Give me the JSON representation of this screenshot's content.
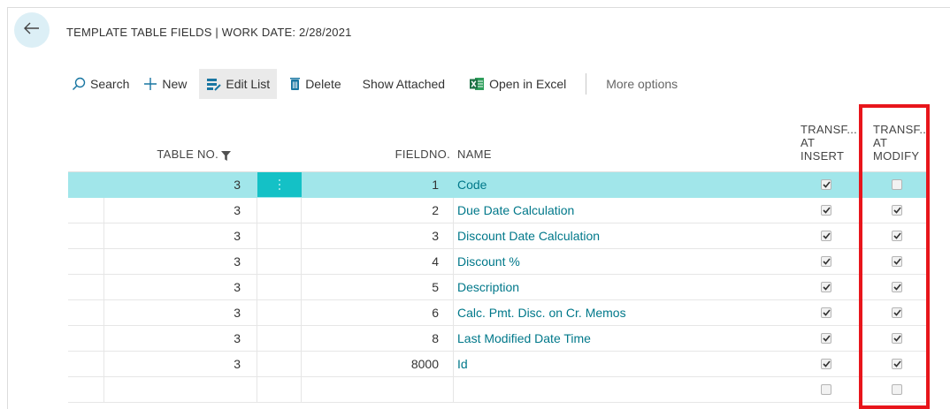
{
  "page": {
    "title": "TEMPLATE TABLE FIELDS | WORK DATE: 2/28/2021"
  },
  "toolbar": {
    "search_label": "Search",
    "new_label": "New",
    "edit_list_label": "Edit List",
    "delete_label": "Delete",
    "show_attached_label": "Show Attached",
    "open_excel_label": "Open in Excel",
    "more_options_label": "More options"
  },
  "columns": {
    "table_no": "TABLE NO.",
    "field_no": "FIELDNO.",
    "name": "NAME",
    "insert_line1": "TRANSF...",
    "insert_line2": "AT",
    "insert_line3": "INSERT",
    "modify_line1": "TRANSF...",
    "modify_line2": "AT",
    "modify_line3": "MODIFY"
  },
  "rows": [
    {
      "table_no": "3",
      "field_no": "1",
      "name": "Code",
      "insert": true,
      "modify": false,
      "selected": true
    },
    {
      "table_no": "3",
      "field_no": "2",
      "name": "Due Date Calculation",
      "insert": true,
      "modify": true
    },
    {
      "table_no": "3",
      "field_no": "3",
      "name": "Discount Date Calculation",
      "insert": true,
      "modify": true
    },
    {
      "table_no": "3",
      "field_no": "4",
      "name": "Discount %",
      "insert": true,
      "modify": true
    },
    {
      "table_no": "3",
      "field_no": "5",
      "name": "Description",
      "insert": true,
      "modify": true
    },
    {
      "table_no": "3",
      "field_no": "6",
      "name": "Calc. Pmt. Disc. on Cr. Memos",
      "insert": true,
      "modify": true
    },
    {
      "table_no": "3",
      "field_no": "8",
      "name": "Last Modified Date Time",
      "insert": true,
      "modify": true
    },
    {
      "table_no": "3",
      "field_no": "8000",
      "name": "Id",
      "insert": true,
      "modify": true
    },
    {
      "table_no": "",
      "field_no": "",
      "name": "",
      "insert": false,
      "modify": false
    }
  ],
  "icons": {
    "back": "back-arrow-icon",
    "search": "search-icon",
    "new": "plus-icon",
    "edit_list": "edit-list-icon",
    "delete": "trash-icon",
    "excel": "excel-icon",
    "filter": "filter-icon",
    "row_actions": "vertical-dots-icon"
  },
  "colors": {
    "accent": "#00788a",
    "selected_row": "#a1e6ea",
    "selected_cell": "#14c1c6",
    "highlight_border": "#e8151b",
    "back_button_bg": "#dceff6",
    "excel_green": "#1e7145"
  }
}
